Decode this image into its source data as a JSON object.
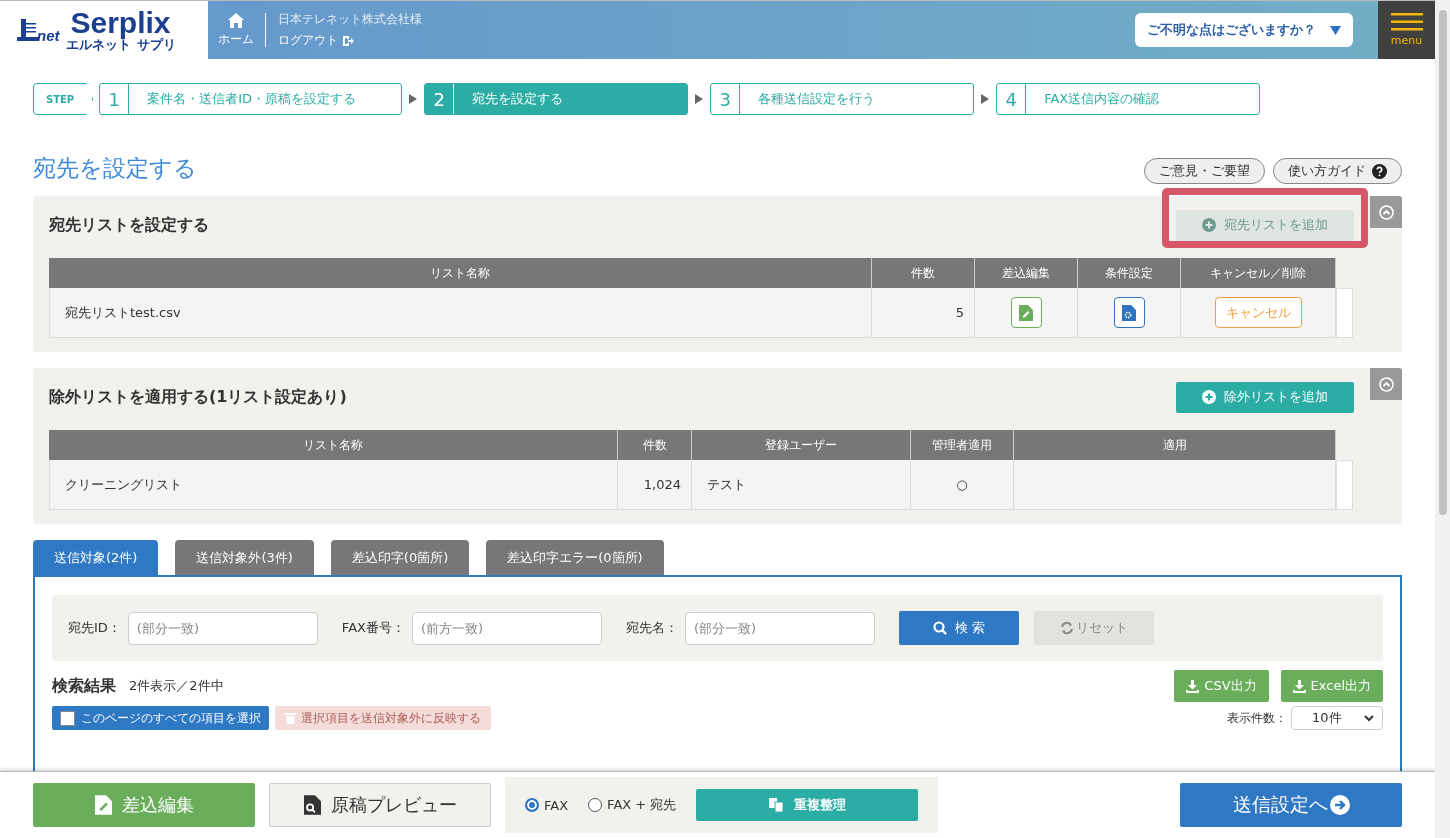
{
  "header": {
    "logo": {
      "mark": "net",
      "main": "Serplix",
      "sub_left": "エルネット",
      "sub_right": "サプリ"
    },
    "home": "ホーム",
    "company": "日本テレネット株式会社様",
    "logout": "ログアウト",
    "help": "ご不明な点はございますか？",
    "menu": "menu"
  },
  "steps_label": "STEP",
  "steps": [
    {
      "number": "1",
      "label": "案件名・送信者ID・原稿を設定する",
      "selected": false
    },
    {
      "number": "2",
      "label": "宛先を設定する",
      "selected": true
    },
    {
      "number": "3",
      "label": "各種送信設定を行う",
      "selected": false
    },
    {
      "number": "4",
      "label": "FAX送信内容の確認",
      "selected": false
    }
  ],
  "page_title": "宛先を設定する",
  "top_buttons": [
    "ご意見・ご要望",
    "使い方ガイド"
  ],
  "dest_section": {
    "title": "宛先リストを設定する",
    "highlighted": true,
    "add_button": {
      "label": "宛先リストを追加",
      "disabled": true
    },
    "columns": [
      "リスト名称",
      "件数",
      "差込編集",
      "条件設定",
      "キャンセル／削除"
    ],
    "rows": [
      {
        "name": "宛先リストtest.csv",
        "count": "5",
        "cancel": "キャンセル"
      }
    ]
  },
  "exclude_section": {
    "title": "除外リストを適用する(1リスト設定あり)",
    "add_button": {
      "label": "除外リストを追加",
      "disabled": false
    },
    "columns": [
      "リスト名称",
      "件数",
      "登録ユーザー",
      "管理者適用",
      "適用"
    ],
    "rows": [
      {
        "name": "クリーニングリスト",
        "count": "1,024",
        "user": "テスト",
        "admin": "○"
      }
    ]
  },
  "tabs": [
    {
      "label": "送信対象(2件)",
      "selected": true
    },
    {
      "label": "送信対象外(3件)",
      "selected": false
    },
    {
      "label": "差込印字(0箇所)",
      "selected": false
    },
    {
      "label": "差込印字エラー(0箇所)",
      "selected": false
    }
  ],
  "search": {
    "fields": [
      {
        "label": "宛先ID：",
        "placeholder": "(部分一致)"
      },
      {
        "label": "FAX番号：",
        "placeholder": "(前方一致)"
      },
      {
        "label": "宛先名：",
        "placeholder": "(部分一致)"
      }
    ],
    "search_button": "検 索",
    "reset_button": {
      "label": "リセット",
      "disabled": true
    }
  },
  "results": {
    "title": "検索結果",
    "summary": "2件表示／2件中",
    "csv_button": "CSV出力",
    "excel_button": "Excel出力",
    "select_all": {
      "label": "このページのすべての項目を選択",
      "checked": false
    },
    "move_button": {
      "label": "選択項目を送信対象外に反映する",
      "disabled": true
    },
    "per_page_label": "表示件数：",
    "per_page": "10件"
  },
  "footer": {
    "merge_button": "差込編集",
    "preview_button": "原稿プレビュー",
    "modes": [
      {
        "label": "FAX",
        "selected": true
      },
      {
        "label": "FAX + 宛先",
        "selected": false
      }
    ],
    "dedupe_button": "重複整理",
    "next_button": "送信設定へ"
  }
}
